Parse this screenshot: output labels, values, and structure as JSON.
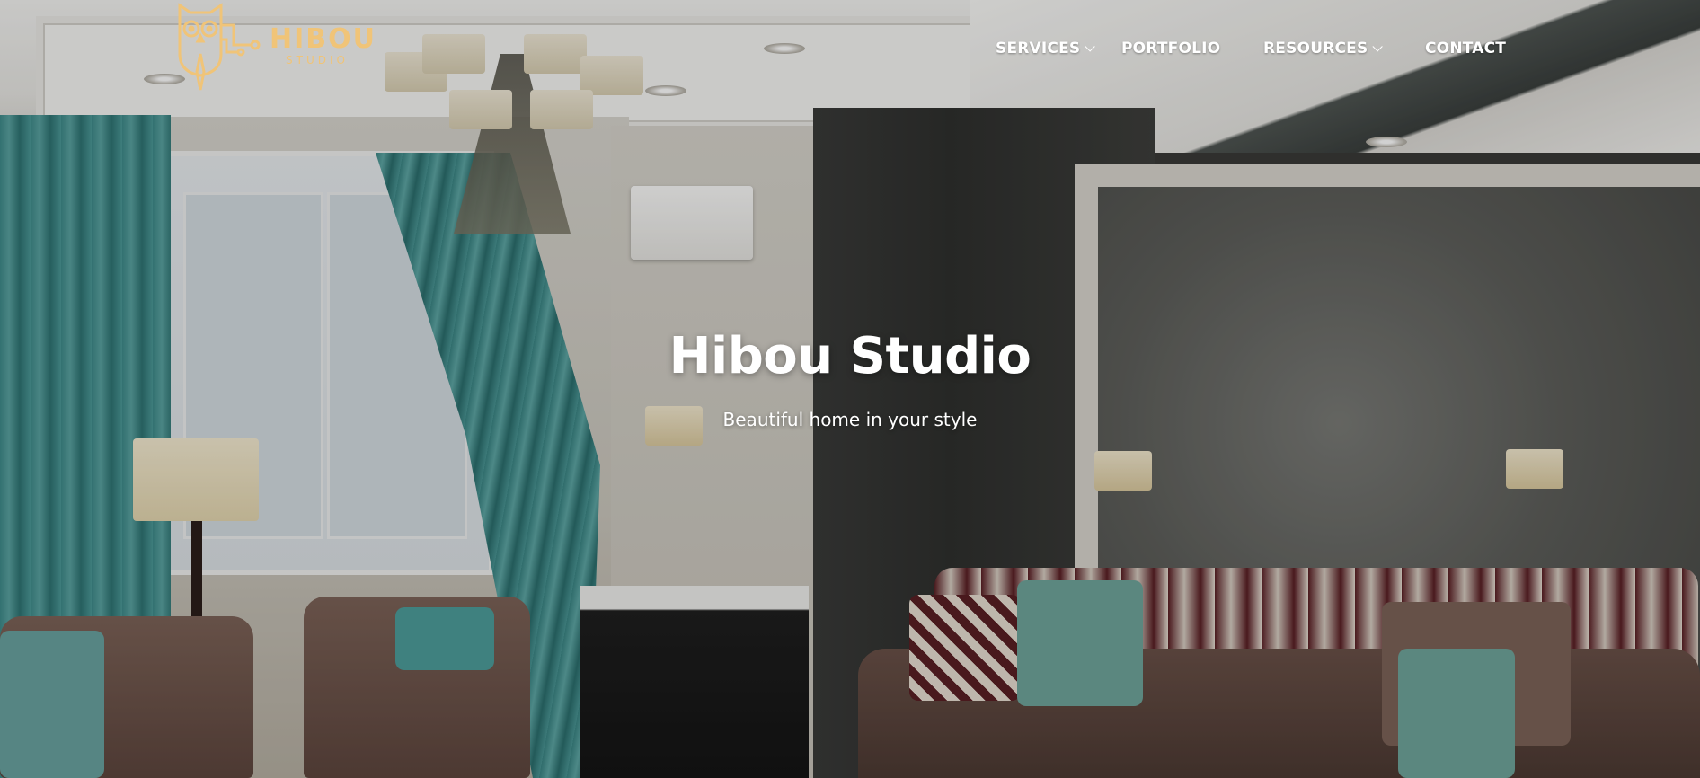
{
  "brand": {
    "name": "HIBOU",
    "tagline": "STUDIO",
    "accent_color": "#f0c478",
    "logo_icon": "owl-icon"
  },
  "nav": {
    "items": [
      {
        "label": "SERVICES",
        "has_dropdown": true
      },
      {
        "label": "PORTFOLIO",
        "has_dropdown": false
      },
      {
        "label": "RESOURCES",
        "has_dropdown": true
      },
      {
        "label": "CONTACT",
        "has_dropdown": false
      }
    ],
    "dropdown_icon": "chevron-down-icon"
  },
  "hero": {
    "title": "Hibou Studio",
    "subtitle": "Beautiful home in your style",
    "background": "living-room-interior-photo"
  }
}
